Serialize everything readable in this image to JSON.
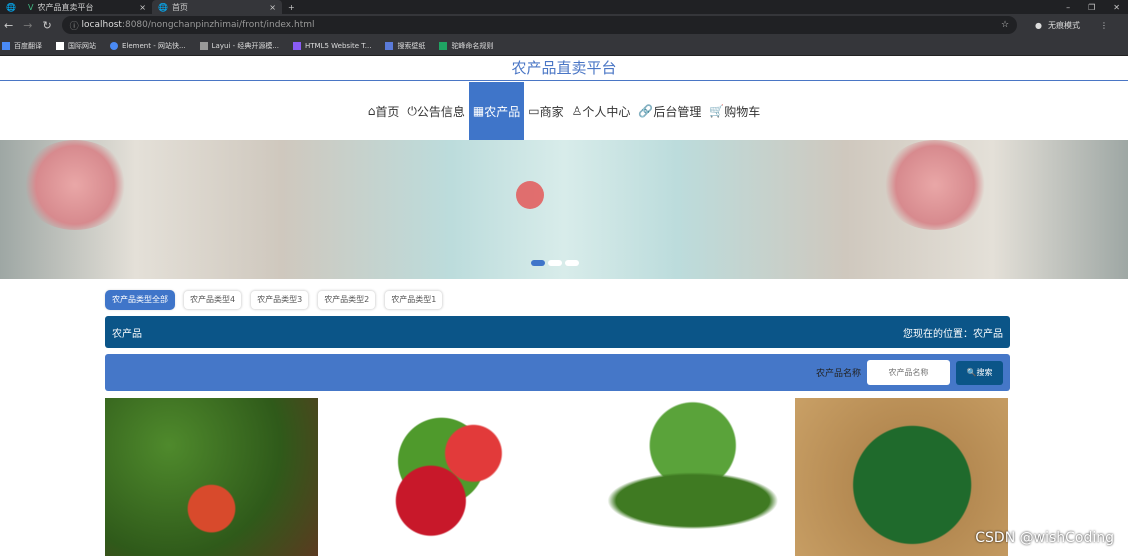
{
  "browser": {
    "tabs": [
      "农产品直卖平台",
      "首页"
    ],
    "url_host": "localhost",
    "url_rest": ":8080/nongchanpinzhimai/front/index.html",
    "profile": "无痕模式",
    "bookmarks": [
      "百度翻译",
      "国际网站",
      "Element - 网站快...",
      "Layui - 经典开源模...",
      "HTML5 Website T...",
      "搜索壁纸",
      "驼峰命名规则"
    ]
  },
  "site": {
    "title": "农产品直卖平台"
  },
  "nav": [
    {
      "icon": "⌂",
      "label": "首页"
    },
    {
      "icon": "⏻",
      "label": "公告信息"
    },
    {
      "icon": "▦",
      "label": "农产品"
    },
    {
      "icon": "▭",
      "label": "商家"
    },
    {
      "icon": "♙",
      "label": "个人中心"
    },
    {
      "icon": "🔗",
      "label": "后台管理"
    },
    {
      "icon": "🛒",
      "label": "购物车"
    }
  ],
  "categories": [
    "农产品类型全部",
    "农产品类型4",
    "农产品类型3",
    "农产品类型2",
    "农产品类型1"
  ],
  "breadcrumb": {
    "title": "农产品",
    "location": "您现在的位置：农产品"
  },
  "search": {
    "label": "农产品名称",
    "placeholder": "农产品名称",
    "button": "搜索"
  },
  "watermark": "CSDN @wishCoding"
}
